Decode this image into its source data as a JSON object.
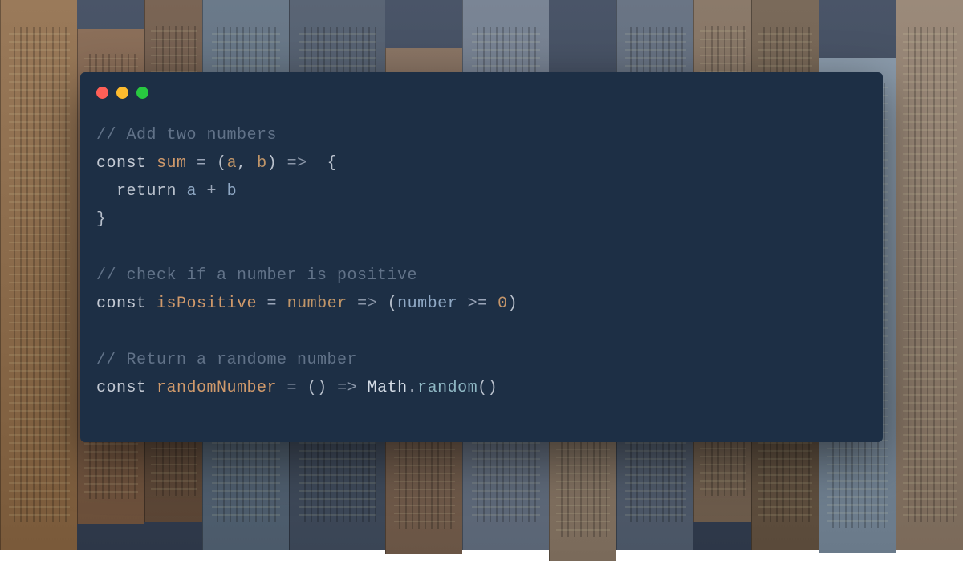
{
  "window": {
    "controls": {
      "close": "close",
      "minimize": "minimize",
      "maximize": "maximize"
    }
  },
  "code": {
    "lines": [
      {
        "type": "comment",
        "text": "// Add two numbers"
      },
      {
        "type": "code",
        "tokens": [
          {
            "c": "keyword",
            "t": "const "
          },
          {
            "c": "function",
            "t": "sum"
          },
          {
            "c": "operator",
            "t": " = "
          },
          {
            "c": "punct",
            "t": "("
          },
          {
            "c": "param",
            "t": "a"
          },
          {
            "c": "punct",
            "t": ", "
          },
          {
            "c": "param",
            "t": "b"
          },
          {
            "c": "punct",
            "t": ") "
          },
          {
            "c": "arrow",
            "t": "=>"
          },
          {
            "c": "punct",
            "t": "  {"
          }
        ]
      },
      {
        "type": "code",
        "tokens": [
          {
            "c": "return",
            "t": "  return "
          },
          {
            "c": "variable",
            "t": "a"
          },
          {
            "c": "operator",
            "t": " + "
          },
          {
            "c": "variable",
            "t": "b"
          }
        ]
      },
      {
        "type": "code",
        "tokens": [
          {
            "c": "punct",
            "t": "}"
          }
        ]
      },
      {
        "type": "blank"
      },
      {
        "type": "comment",
        "text": "// check if a number is positive"
      },
      {
        "type": "code",
        "tokens": [
          {
            "c": "keyword",
            "t": "const "
          },
          {
            "c": "function",
            "t": "isPositive"
          },
          {
            "c": "operator",
            "t": " = "
          },
          {
            "c": "param",
            "t": "number"
          },
          {
            "c": "arrow",
            "t": " => "
          },
          {
            "c": "punct",
            "t": "("
          },
          {
            "c": "variable",
            "t": "number"
          },
          {
            "c": "operator",
            "t": " >= "
          },
          {
            "c": "number",
            "t": "0"
          },
          {
            "c": "punct",
            "t": ")"
          }
        ]
      },
      {
        "type": "blank"
      },
      {
        "type": "comment",
        "text": "// Return a randome number"
      },
      {
        "type": "code",
        "tokens": [
          {
            "c": "keyword",
            "t": "const "
          },
          {
            "c": "function",
            "t": "randomNumber"
          },
          {
            "c": "operator",
            "t": " = "
          },
          {
            "c": "punct",
            "t": "() "
          },
          {
            "c": "arrow",
            "t": "=>"
          },
          {
            "c": "object",
            "t": " Math"
          },
          {
            "c": "punct",
            "t": "."
          },
          {
            "c": "method",
            "t": "random"
          },
          {
            "c": "punct",
            "t": "()"
          }
        ]
      }
    ]
  },
  "colors": {
    "window_bg": "#1d2f45",
    "comment": "#617288",
    "keyword": "#c3c9d3",
    "function": "#d19a6b",
    "dot_red": "#ff5f57",
    "dot_yellow": "#febc2e",
    "dot_green": "#28c840"
  }
}
